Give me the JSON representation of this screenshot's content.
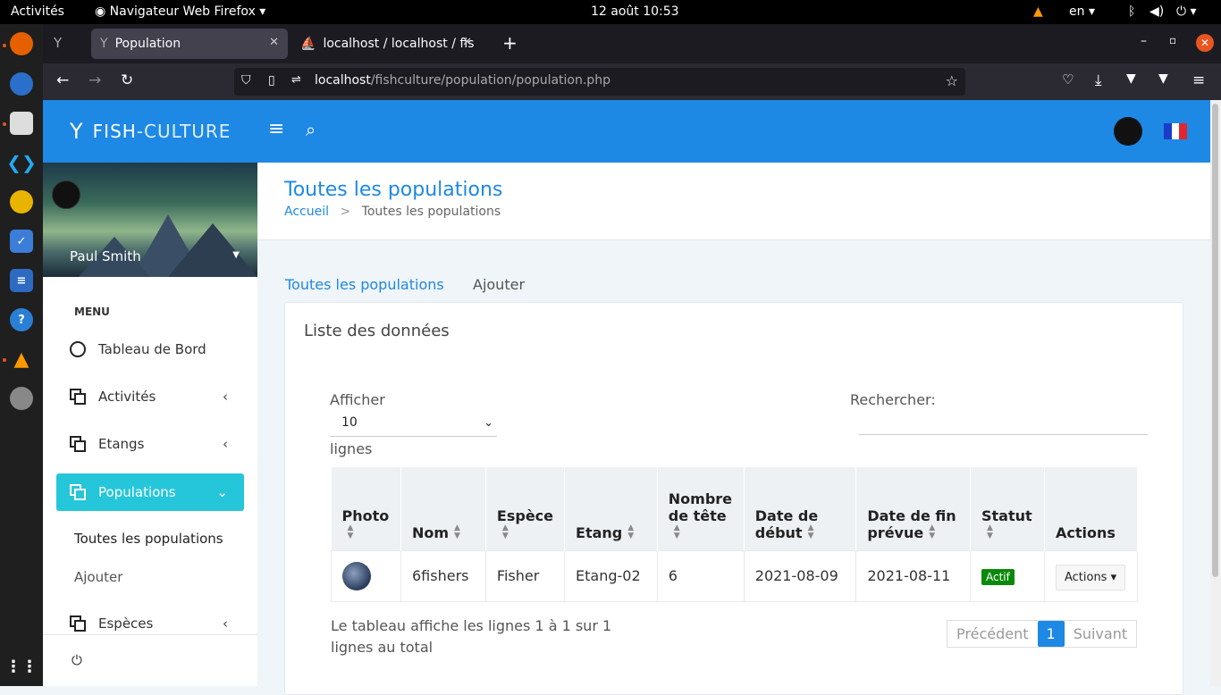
{
  "system": {
    "activities": "Activités",
    "app_name": "Navigateur Web Firefox",
    "datetime": "12 août  10:53",
    "lang": "en"
  },
  "browser": {
    "tabs": [
      {
        "label": "Population",
        "active": true
      },
      {
        "label": "localhost / localhost / fish",
        "active": false
      }
    ],
    "url_host": "localhost",
    "url_path": "/fishculture/population/population.php"
  },
  "app": {
    "logo_bold": "FISH",
    "logo_rest": "-CULTURE",
    "user_name": "Paul Smith",
    "menu_header": "MENU",
    "menu": [
      {
        "label": "Tableau de Bord",
        "icon": "dashboard-icon",
        "has_arrow": false
      },
      {
        "label": "Activités",
        "icon": "copy-icon",
        "has_arrow": true
      },
      {
        "label": "Etangs",
        "icon": "copy-icon",
        "has_arrow": true
      },
      {
        "label": "Populations",
        "icon": "copy-icon",
        "has_arrow": true,
        "active": true
      },
      {
        "label": "Espèces",
        "icon": "copy-icon",
        "has_arrow": true
      }
    ],
    "submenu": [
      "Toutes les populations",
      "Ajouter"
    ],
    "accent": "#1e88e5",
    "active_color": "#26c6da"
  },
  "page": {
    "title": "Toutes les populations",
    "breadcrumb": {
      "home": "Accueil",
      "sep": ">",
      "current": "Toutes les populations"
    },
    "tabs": [
      "Toutes les populations",
      "Ajouter"
    ]
  },
  "card": {
    "title": "Liste des données",
    "show_label": "Afficher",
    "show_value": "10",
    "rows_label": "lignes",
    "search_label": "Rechercher:",
    "columns": [
      "Photo",
      "Nom",
      "Espèce",
      "Etang",
      "Nombre de tête",
      "Date de début",
      "Date de fin prévue",
      "Statut",
      "Actions"
    ],
    "rows": [
      {
        "nom": "6fishers",
        "espece": "Fisher",
        "etang": "Etang-02",
        "nombre": "6",
        "debut": "2021-08-09",
        "fin": "2021-08-11",
        "statut": "Actif",
        "actions": "Actions"
      }
    ],
    "info": "Le tableau affiche les lignes 1 à 1 sur 1 lignes au total",
    "pager": {
      "prev": "Précédent",
      "page": "1",
      "next": "Suivant"
    }
  }
}
